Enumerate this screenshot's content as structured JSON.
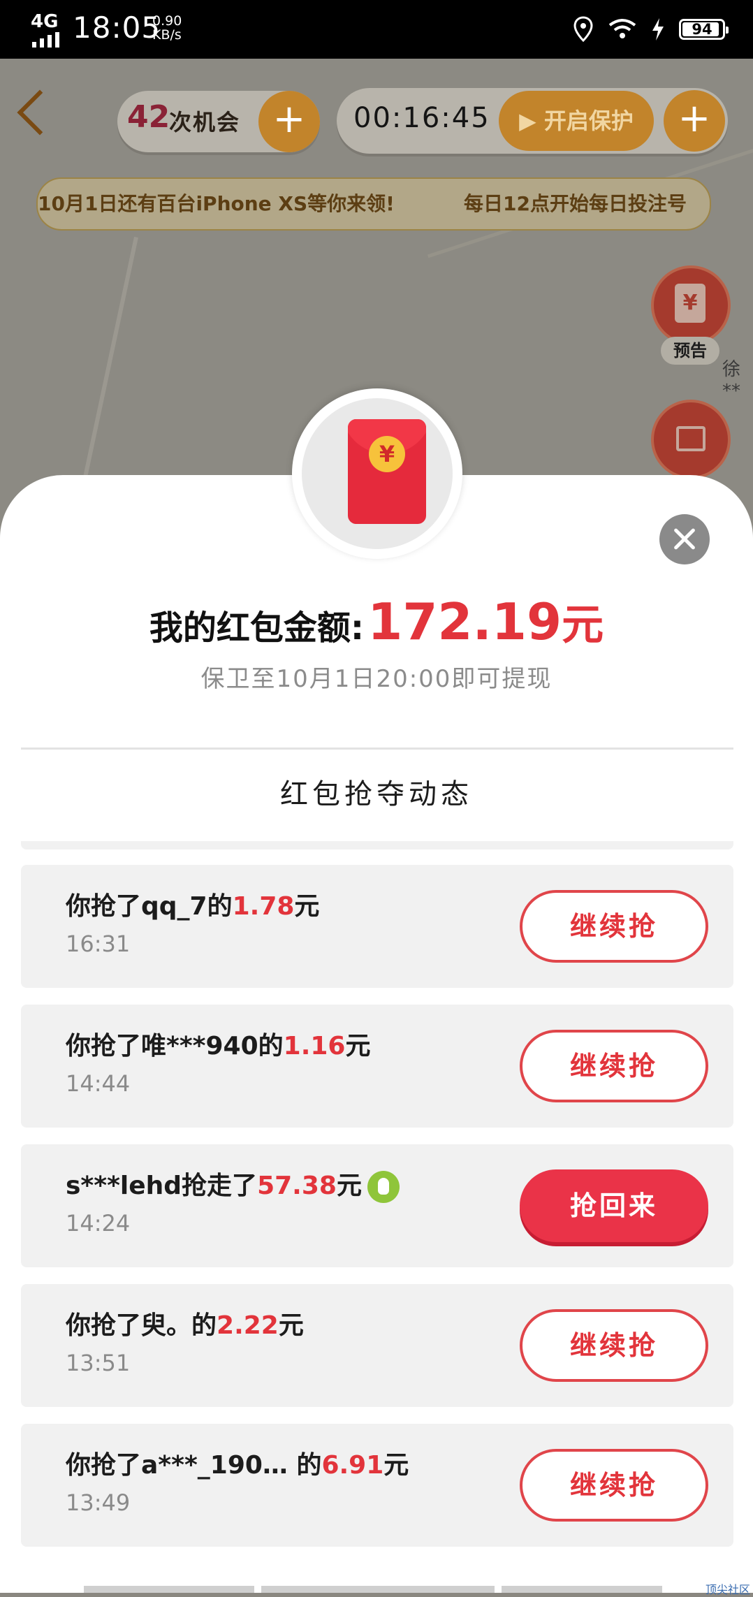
{
  "status_bar": {
    "network": "4G",
    "time": "18:05",
    "speed_value": "0.90",
    "speed_unit": "KB/s",
    "battery": "94",
    "battery_level": 0.94
  },
  "game": {
    "chance_count": "42",
    "chance_label": "次机会",
    "timer": "00:16:45",
    "protect_label": "开启保护",
    "plus": "+",
    "banner_left": "10月1日还有百台iPhone XS等你来领!",
    "banner_right": "每日12点开始每日投注号",
    "side_label": "预告",
    "side_user": "徐**",
    "side_icon_yuan": "¥"
  },
  "modal": {
    "amount_label": "我的红包金额:",
    "amount_value": "172.19",
    "amount_unit": "元",
    "hint": "保卫至10月1日20:00即可提现",
    "feed_title": "红包抢夺动态",
    "yuan_symbol": "¥"
  },
  "feed": [
    {
      "prefix": "你抢了qq_7的",
      "amount": "1.78",
      "suffix": "元",
      "time": "16:31",
      "button": "继续抢",
      "filled": false
    },
    {
      "prefix": "你抢了唯***940的",
      "amount": "1.16",
      "suffix": "元",
      "time": "14:44",
      "button": "继续抢",
      "filled": false
    },
    {
      "prefix": "s***lehd抢走了",
      "amount": "57.38",
      "suffix": "元",
      "time": "14:24",
      "button": "抢回来",
      "filled": true
    },
    {
      "prefix": "你抢了臾。的",
      "amount": "2.22",
      "suffix": "元",
      "time": "13:51",
      "button": "继续抢",
      "filled": false
    },
    {
      "prefix": "你抢了a***_190…  的",
      "amount": "6.91",
      "suffix": "元",
      "time": "13:49",
      "button": "继续抢",
      "filled": false
    }
  ],
  "watermark": "顶尖社区",
  "colors": {
    "accent_red": "#e2343b",
    "button_red": "#ea3348",
    "map_dim": "#8c8a83",
    "gold": "#c2842b"
  }
}
